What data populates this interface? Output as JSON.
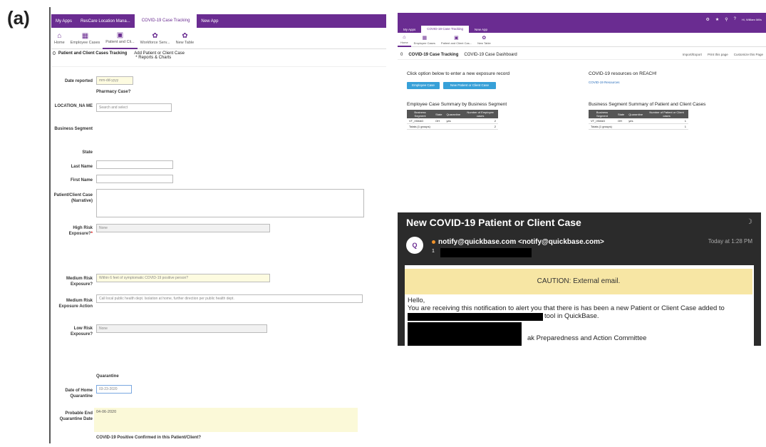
{
  "panel_label": "(a)",
  "left_app": {
    "topbar": {
      "my_apps": "My Apps",
      "location_tab": "ResCare Location Mana...",
      "active_tab": "COVID-19 Case Tracking",
      "new_app": "New App"
    },
    "nav": [
      {
        "label": "Home",
        "icon": "home-icon",
        "glyph": "⌂"
      },
      {
        "label": "Employee Cases",
        "icon": "calendar-icon",
        "glyph": "▦"
      },
      {
        "label": "Patient and Cli...",
        "icon": "calendar-icon",
        "glyph": "▣"
      },
      {
        "label": "Workforce Serv...",
        "icon": "gear-icon",
        "glyph": "✿"
      },
      {
        "label": "New Table",
        "icon": "plus-icon",
        "glyph": "✿"
      }
    ],
    "crumb": {
      "title": "Patient and Client Cases Tracking",
      "action": "Add Patient or Client Case",
      "sub": "* Reports & Charts",
      "zero": "0"
    },
    "form": {
      "date_reported_label": "Date reported",
      "date_reported_placeholder": "mm-dd-yyyy",
      "pharmacy_case": "Pharmacy Case?",
      "location_label": "LOCATION_NA ME",
      "location_placeholder": "Search and select",
      "business_segment_label": "Business Segment",
      "state_label": "State",
      "last_name_label": "Last Name",
      "first_name_label": "First Name",
      "narrative_label": "Patient/Client Case (Narrative)",
      "high_risk_label": "High Risk Exposure?",
      "high_risk_required": "*",
      "high_risk_value": "None",
      "medium_risk_label": "Medium Risk Exposure?",
      "medium_risk_value": "Within 6 feet of symptomatic COVID-19 positive person?",
      "medium_action_label": "Medium Risk Exposure Action",
      "medium_action_value": "Call local public health dept. Isolation at home, further direction per public health dept.",
      "low_risk_label": "Low Risk Exposure?",
      "low_risk_value": "None",
      "quarantine": "Quarantine",
      "date_home_label": "Date of Home Quarantine",
      "date_home_value": "03-23-2020",
      "end_label": "Probable End Quarantine Date",
      "end_value": "04-06-2020",
      "confirmed": "COVID-19 Positive Confirmed in this Patient/Client?"
    }
  },
  "right_app": {
    "topbar_user": "Hi, William Mills",
    "tabs": {
      "my_apps": "My Apps",
      "active": "COVID-19 Case Tracking",
      "new_app": "New App"
    },
    "nav": [
      {
        "label": "Home",
        "glyph": "⌂"
      },
      {
        "label": "Employee Cases",
        "glyph": "▦"
      },
      {
        "label": "Patient and Client Cas...",
        "glyph": "▣"
      },
      {
        "label": "New Table",
        "glyph": "✿"
      }
    ],
    "crumb": {
      "zero": "0",
      "title": "COVID-19 Case Tracking",
      "page": "COVID-19 Case Dashboard",
      "import": "Import/Export",
      "print": "Print this page",
      "customize": "Customize this Page"
    },
    "click_option": "Click option below to enter a new exposure record",
    "btn_employee": "Employee Case",
    "btn_patient": "New Patient or Client Case",
    "resources_title": "COVID-19 resources on REACH!",
    "resources_link": "COVID-19 Resources",
    "emp_summary_title": "Employee Case Summary by Business Segment",
    "emp_table": {
      "headers": [
        "Business Segment",
        "State",
        "Quarantine",
        "Number of Employee cases"
      ],
      "rows": [
        [
          "VT_IXMAG",
          "OH",
          "yes",
          "2"
        ]
      ],
      "totals": [
        "Totals (1 groups)",
        "",
        "",
        "2"
      ]
    },
    "pat_summary_title": "Business Segment Summary of Patient and Client Cases",
    "pat_table": {
      "headers": [
        "Business Segment",
        "State",
        "Quarantine",
        "Number of Patient or Client cases"
      ],
      "rows": [
        [
          "VT_IXMAG",
          "OH",
          "yes",
          "1"
        ]
      ],
      "totals": [
        "Totals (1 groups)",
        "",
        "",
        "1"
      ]
    }
  },
  "email": {
    "subject": "New COVID-19 Patient or Client Case",
    "from": "notify@quickbase.com <notify@quickbase.com>",
    "time": "Today at 1:28 PM",
    "to_fragment": "1",
    "caution": "CAUTION: External email.",
    "hello": "Hello,",
    "line1": "You are receiving this notification to alert you that there is has been a new Patient or Client Case added to",
    "line2": "tool in QuickBase.",
    "line3": "ak Preparedness and Action Committee"
  }
}
